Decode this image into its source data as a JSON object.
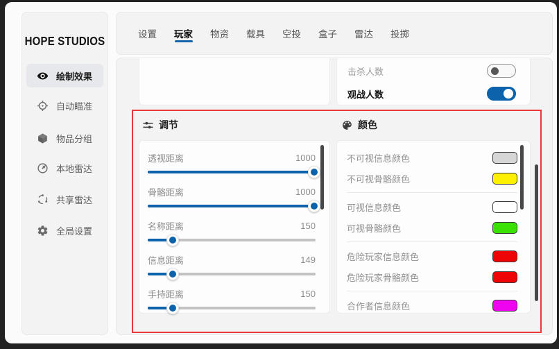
{
  "brand": {
    "title": "HOPE STUDIOS"
  },
  "sidebar": {
    "items": [
      {
        "label": "绘制效果",
        "icon": "eye",
        "active": true
      },
      {
        "label": "自动瞄准",
        "icon": "crosshair",
        "active": false
      },
      {
        "label": "物品分组",
        "icon": "cube",
        "active": false
      },
      {
        "label": "本地雷达",
        "icon": "radar",
        "active": false
      },
      {
        "label": "共享雷达",
        "icon": "share-network",
        "active": false
      },
      {
        "label": "全局设置",
        "icon": "gear",
        "active": false
      }
    ]
  },
  "tabs": {
    "items": [
      {
        "label": "设置",
        "active": false
      },
      {
        "label": "玩家",
        "active": true
      },
      {
        "label": "物资",
        "active": false
      },
      {
        "label": "载具",
        "active": false
      },
      {
        "label": "空投",
        "active": false
      },
      {
        "label": "盒子",
        "active": false
      },
      {
        "label": "雷达",
        "active": false
      },
      {
        "label": "投掷",
        "active": false
      }
    ]
  },
  "player_header": {
    "rows": [
      {
        "label": "击杀人数",
        "on": false
      },
      {
        "label": "观战人数",
        "on": true
      }
    ]
  },
  "adjust": {
    "title": "调节",
    "sliders": [
      {
        "label": "透视距离",
        "value": "1000",
        "percent": 99
      },
      {
        "label": "骨骼距离",
        "value": "1000",
        "percent": 99
      },
      {
        "label": "名称距离",
        "value": "150",
        "percent": 15
      },
      {
        "label": "信息距离",
        "value": "149",
        "percent": 15
      },
      {
        "label": "手持距离",
        "value": "150",
        "percent": 15
      }
    ]
  },
  "colors_section": {
    "title": "颜色",
    "rows": [
      {
        "label": "不可视信息颜色",
        "color": "#d6d6d6"
      },
      {
        "label": "不可视骨骼颜色",
        "color": "#fdf000"
      },
      {
        "label": "可视信息颜色",
        "color": "#ffffff"
      },
      {
        "label": "可视骨骼颜色",
        "color": "#3be004"
      },
      {
        "label": "危险玩家信息颜色",
        "color": "#ee0404"
      },
      {
        "label": "危险玩家骨骼颜色",
        "color": "#ee0404"
      },
      {
        "label": "合作者信息颜色",
        "color": "#ee04ee"
      }
    ]
  },
  "ui_colors": {
    "accent_blue": "#0d63ab",
    "highlight_red": "#e8383d",
    "scrollbar": "#474747"
  }
}
